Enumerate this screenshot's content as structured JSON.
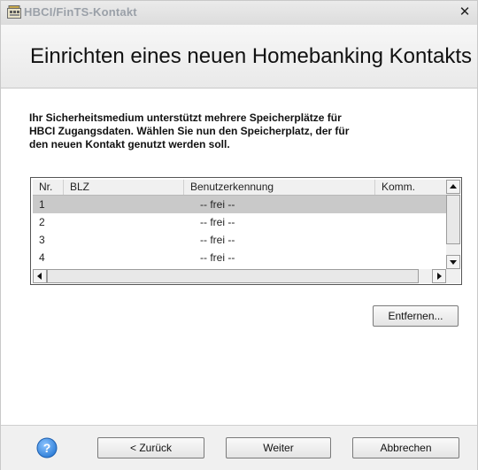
{
  "window": {
    "title": "HBCI/FinTS-Kontakt",
    "close_glyph": "✕"
  },
  "header": {
    "title": "Einrichten eines neuen Homebanking Kontakts"
  },
  "instruction": "Ihr Sicherheitsmedium unterstützt mehrere Speicherplätze für HBCI Zugangsdaten. Wählen Sie nun den Speicherplatz, der für den neuen Kontakt genutzt werden soll.",
  "table": {
    "columns": [
      "Nr.",
      "BLZ",
      "Benutzerkennung",
      "Komm."
    ],
    "rows": [
      {
        "nr": "1",
        "blz": "",
        "user": "-- frei --",
        "comm": "",
        "selected": true
      },
      {
        "nr": "2",
        "blz": "",
        "user": "-- frei --",
        "comm": "",
        "selected": false
      },
      {
        "nr": "3",
        "blz": "",
        "user": "-- frei --",
        "comm": "",
        "selected": false
      },
      {
        "nr": "4",
        "blz": "",
        "user": "-- frei --",
        "comm": "",
        "selected": false
      }
    ]
  },
  "buttons": {
    "remove": "Entfernen...",
    "back": "< Zurück",
    "next": "Weiter",
    "cancel": "Abbrechen"
  },
  "icons": {
    "app": "hbci-app-icon",
    "help": "help-icon",
    "close": "close-icon"
  },
  "colors": {
    "selected_row": "#c9c9c9",
    "help_blue": "#2f7fd8"
  }
}
